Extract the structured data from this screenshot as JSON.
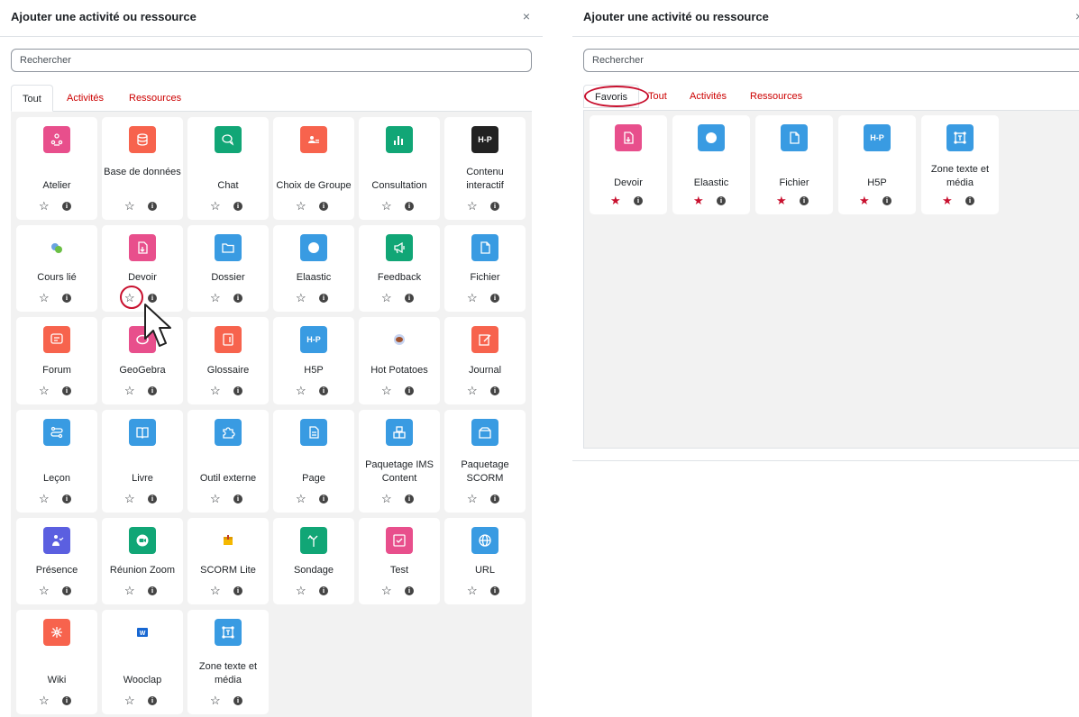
{
  "left": {
    "title": "Ajouter une activité ou ressource",
    "close": "×",
    "search_placeholder": "Rechercher",
    "tabs": [
      "Tout",
      "Activités",
      "Ressources"
    ],
    "items": [
      {
        "label": "Atelier",
        "icon": "workshop-icon",
        "color": "#e84f8c"
      },
      {
        "label": "Base de données",
        "icon": "database-icon",
        "color": "#f7634d"
      },
      {
        "label": "Chat",
        "icon": "chat-icon",
        "color": "#11a676"
      },
      {
        "label": "Choix de Groupe",
        "icon": "group-choice-icon",
        "color": "#f7634d"
      },
      {
        "label": "Consultation",
        "icon": "chart-icon",
        "color": "#11a676"
      },
      {
        "label": "Contenu interactif",
        "icon": "h5p-icon",
        "color": "#222222"
      },
      {
        "label": "Cours lié",
        "icon": "linked-course-icon",
        "color": "#ffffff"
      },
      {
        "label": "Devoir",
        "icon": "assignment-icon",
        "color": "#e84f8c"
      },
      {
        "label": "Dossier",
        "icon": "folder-icon",
        "color": "#399be2"
      },
      {
        "label": "Elaastic",
        "icon": "circle-icon",
        "color": "#399be2"
      },
      {
        "label": "Feedback",
        "icon": "megaphone-icon",
        "color": "#11a676"
      },
      {
        "label": "Fichier",
        "icon": "file-icon",
        "color": "#399be2"
      },
      {
        "label": "Forum",
        "icon": "forum-icon",
        "color": "#f7634d"
      },
      {
        "label": "GeoGebra",
        "icon": "geogebra-icon",
        "color": "#e84f8c"
      },
      {
        "label": "Glossaire",
        "icon": "glossary-icon",
        "color": "#f7634d"
      },
      {
        "label": "H5P",
        "icon": "h5p-icon",
        "color": "#399be2"
      },
      {
        "label": "Hot Potatoes",
        "icon": "hot-potatoes-icon",
        "color": "#ffffff"
      },
      {
        "label": "Journal",
        "icon": "journal-icon",
        "color": "#f7634d"
      },
      {
        "label": "Leçon",
        "icon": "lesson-icon",
        "color": "#399be2"
      },
      {
        "label": "Livre",
        "icon": "book-icon",
        "color": "#399be2"
      },
      {
        "label": "Outil externe",
        "icon": "puzzle-icon",
        "color": "#399be2"
      },
      {
        "label": "Page",
        "icon": "page-icon",
        "color": "#399be2"
      },
      {
        "label": "Paquetage IMS Content",
        "icon": "ims-package-icon",
        "color": "#399be2"
      },
      {
        "label": "Paquetage SCORM",
        "icon": "scorm-package-icon",
        "color": "#399be2"
      },
      {
        "label": "Présence",
        "icon": "attendance-icon",
        "color": "#5b5fe0"
      },
      {
        "label": "Réunion Zoom",
        "icon": "zoom-icon",
        "color": "#11a676"
      },
      {
        "label": "SCORM Lite",
        "icon": "scorm-lite-icon",
        "color": "#ffffff"
      },
      {
        "label": "Sondage",
        "icon": "survey-icon",
        "color": "#11a676"
      },
      {
        "label": "Test",
        "icon": "quiz-icon",
        "color": "#e84f8c"
      },
      {
        "label": "URL",
        "icon": "globe-icon",
        "color": "#399be2"
      },
      {
        "label": "Wiki",
        "icon": "wiki-icon",
        "color": "#f7634d"
      },
      {
        "label": "Wooclap",
        "icon": "wooclap-icon",
        "color": "#ffffff"
      },
      {
        "label": "Zone texte et média",
        "icon": "text-media-icon",
        "color": "#399be2"
      }
    ]
  },
  "right": {
    "title": "Ajouter une activité ou ressource",
    "close": "×",
    "search_placeholder": "Rechercher",
    "tabs": [
      "Favoris",
      "Tout",
      "Activités",
      "Ressources"
    ],
    "items": [
      {
        "label": "Devoir",
        "icon": "assignment-icon",
        "color": "#e84f8c"
      },
      {
        "label": "Elaastic",
        "icon": "circle-icon",
        "color": "#399be2"
      },
      {
        "label": "Fichier",
        "icon": "file-icon",
        "color": "#399be2"
      },
      {
        "label": "H5P",
        "icon": "h5p-icon",
        "color": "#399be2"
      },
      {
        "label": "Zone texte et média",
        "icon": "text-media-icon",
        "color": "#399be2"
      }
    ]
  },
  "glyphs": {
    "star_empty": "☆",
    "star_full": "★",
    "info": "i"
  }
}
